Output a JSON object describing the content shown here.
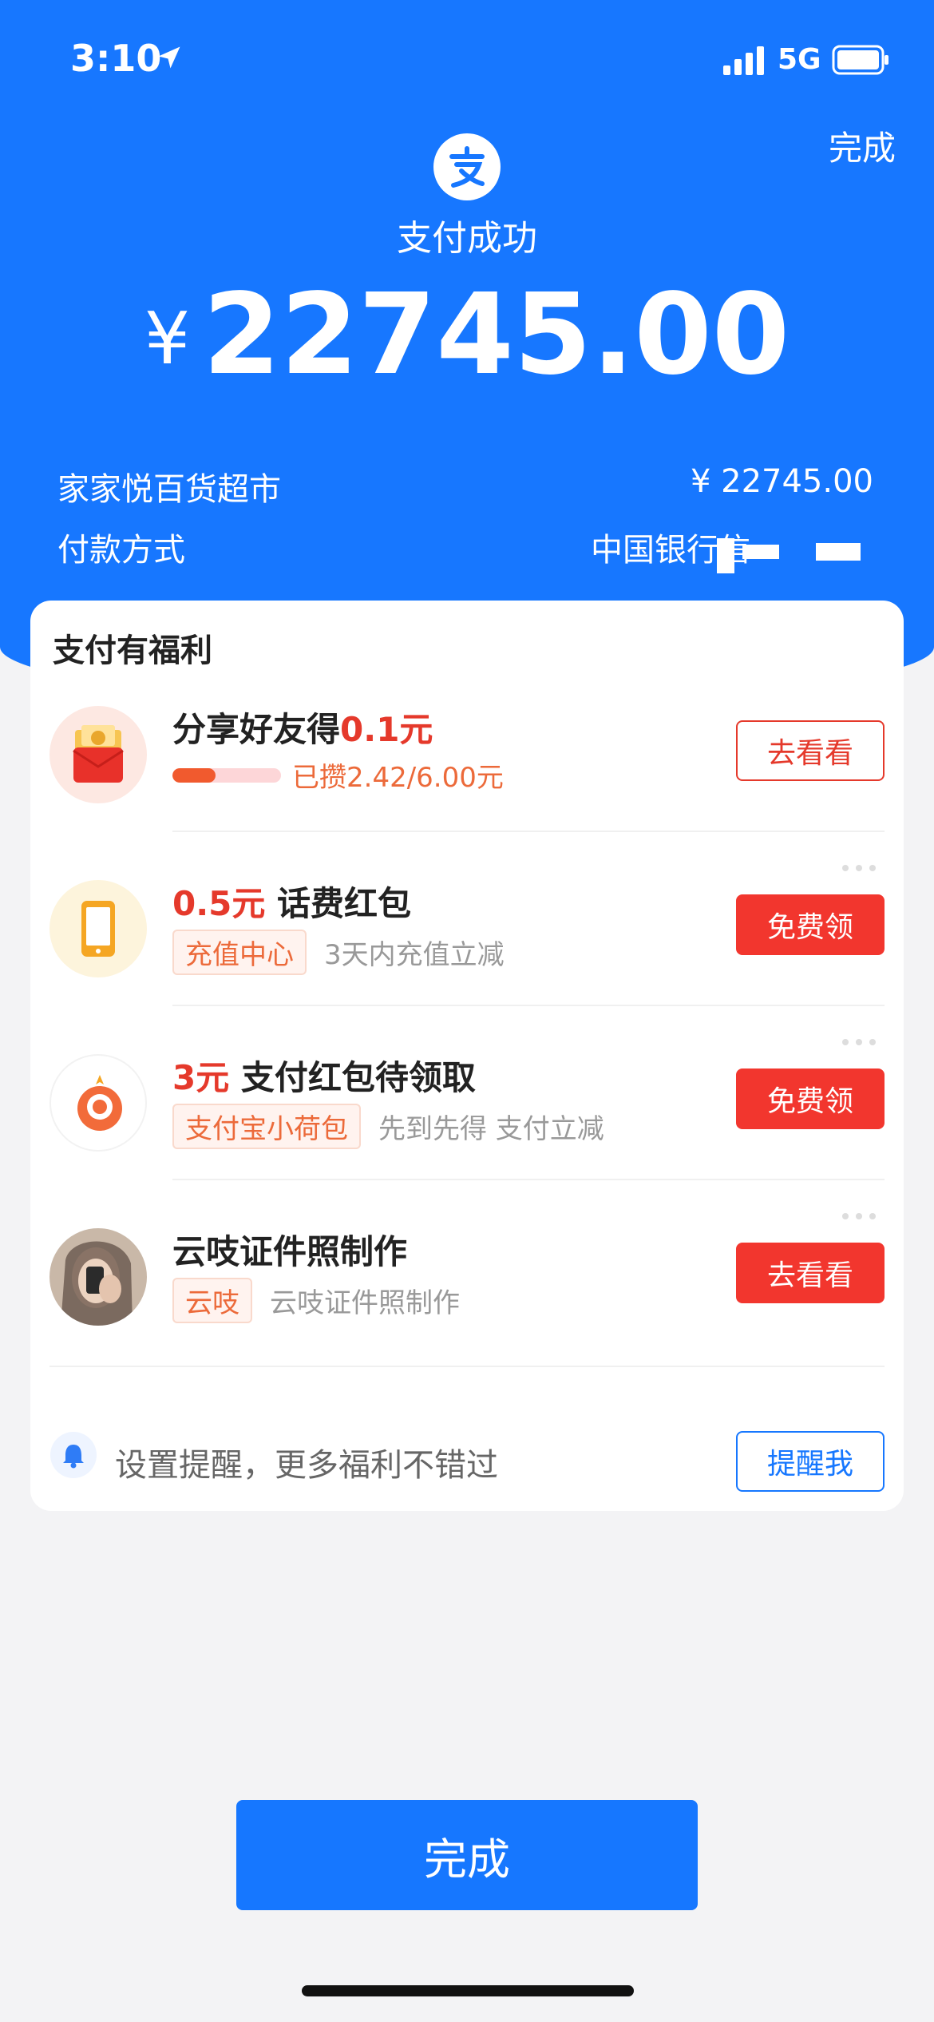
{
  "status_bar": {
    "time": "3:10",
    "network": "5G"
  },
  "header": {
    "done_label": "完成",
    "title": "支付成功",
    "currency": "¥",
    "amount": "22745.00",
    "merchant": "家家悦百货超市",
    "merchant_amount": "¥ 22745.00",
    "payment_label": "付款方式",
    "payment_value": "中国银行信"
  },
  "card": {
    "title": "支付有福利",
    "items": [
      {
        "title_pre": "分享好友得",
        "title_red": "0.1元",
        "title_post": "",
        "progress": 0.4,
        "progress_text": "已攒2.42/6.00元",
        "button": "去看看"
      },
      {
        "title_pre": "",
        "title_red": "0.5元",
        "title_post": " 话费红包",
        "tag": "充值中心",
        "desc": "3天内充值立减",
        "button": "免费领"
      },
      {
        "title_pre": "",
        "title_red": "3元",
        "title_post": " 支付红包待领取",
        "tag": "支付宝小荷包",
        "desc": "先到先得 支付立减",
        "button": "免费领"
      },
      {
        "title_pre": "云吱证件照制作",
        "title_red": "",
        "title_post": "",
        "tag": "云吱",
        "desc": "云吱证件照制作",
        "button": "去看看"
      }
    ],
    "remind_text": "设置提醒，更多福利不错过",
    "remind_button": "提醒我"
  },
  "bottom_button": "完成",
  "colors": {
    "brand_blue": "#1777ff",
    "accent_red": "#e5392b"
  }
}
